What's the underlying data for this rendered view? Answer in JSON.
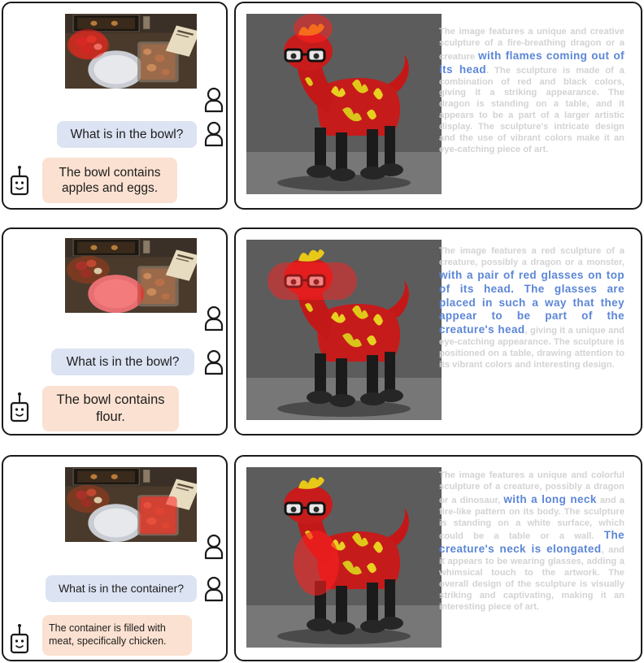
{
  "rows": [
    {
      "question": "What is in the bowl?",
      "answer": "The bowl contains apples and eggs.",
      "desc_before": "The image features a unique and creative sculpture of a fire-breathing dragon or a creature ",
      "desc_h1": "with flames coming out of its head",
      "desc_middle": ". The sculpture is made of a combination of red and black colors, giving it a striking appearance. The dragon is standing on a table, and it appears to be a part of a larger artistic display. The sculpture's intricate design and the use of vibrant colors make it an eye-catching piece of art.",
      "desc_h2": "",
      "desc_after": ""
    },
    {
      "question": "What is in the bowl?",
      "answer": "The bowl contains flour.",
      "desc_before": "The image features a red sculpture of a creature, possibly a dragon or a monster, ",
      "desc_h1": "with a pair of red glasses on top of its head. The glasses are placed in such a way that they appear to be part of the creature's head",
      "desc_middle": ", giving it a unique and eye-catching appearance. The sculpture is positioned on a table, drawing attention to its vibrant colors and interesting design.",
      "desc_h2": "",
      "desc_after": ""
    },
    {
      "question": "What is in the container?",
      "answer": "The container is filled with meat, specifically chicken.",
      "desc_before": "The image features a unique and colorful sculpture of a creature, possibly a dragon or a dinosaur, ",
      "desc_h1": "with a long neck",
      "desc_middle": " and a fire-like pattern on its body. The sculpture is standing on a white surface, which could be a table or a wall. ",
      "desc_h2": "The creature's neck is elongated",
      "desc_after": ", and it appears to be wearing glasses, adding a whimsical touch to the artwork. The overall design of the sculpture is visually striking and captivating, making it an interesting piece of art."
    }
  ],
  "colors": {
    "question_bg": "#dce3f3",
    "answer_bg": "#fbe1d1",
    "highlight_text": "#5b86d6",
    "faded_text": "#d3d3d3",
    "mask_red": "#ff2020"
  },
  "icons": {
    "user": "user-icon",
    "bot": "robot-icon"
  }
}
